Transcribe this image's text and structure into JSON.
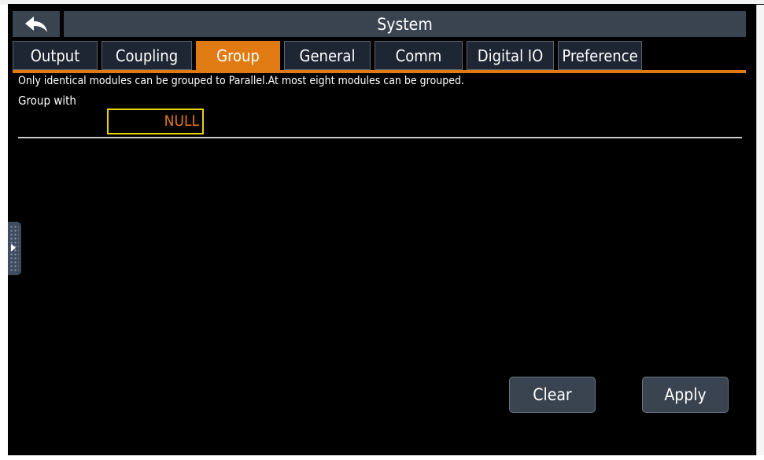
{
  "title": "System",
  "tabs": [
    {
      "label": "Output"
    },
    {
      "label": "Coupling"
    },
    {
      "label": "Group"
    },
    {
      "label": "General"
    },
    {
      "label": "Comm"
    },
    {
      "label": "Digital IO"
    },
    {
      "label": "Preference"
    }
  ],
  "active_tab": "Group",
  "info_text": "Only identical modules can be grouped to Parallel.At most eight modules can be grouped.",
  "group": {
    "label": "Group with",
    "value": "NULL"
  },
  "buttons": {
    "clear": "Clear",
    "apply": "Apply"
  },
  "colors": {
    "accent": "#e07a12",
    "focus_border": "#e8d400",
    "bar_bg": "#3a4451",
    "tab_bg": "#1e2633",
    "background": "#000000"
  },
  "icons": {
    "back": "back-arrow-icon",
    "side_handle": "expand-right-icon"
  }
}
